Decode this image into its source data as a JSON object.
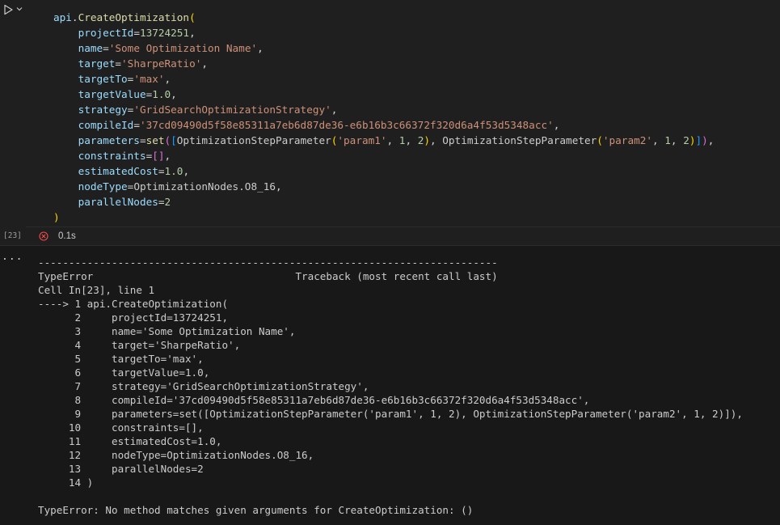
{
  "cell": {
    "execution_count": "[23]",
    "status_icon": "error-circle-icon",
    "duration": "0.1s",
    "code": {
      "line1_obj": "api",
      "line1_fn": "CreateOptimization",
      "projectId_name": "projectId",
      "projectId_value": "13724251",
      "name_name": "name",
      "name_value": "'Some Optimization Name'",
      "target_name": "target",
      "target_value": "'SharpeRatio'",
      "targetTo_name": "targetTo",
      "targetTo_value": "'max'",
      "targetValue_name": "targetValue",
      "targetValue_value": "1.0",
      "strategy_name": "strategy",
      "strategy_value": "'GridSearchOptimizationStrategy'",
      "compileId_name": "compileId",
      "compileId_value": "'37cd09490d5f58e85311a7eb6d87de36-e6b16b3c66372f320d6a4f53d5348acc'",
      "parameters_name": "parameters",
      "set_fn": "set",
      "osp_fn": "OptimizationStepParameter",
      "param1": "'param1'",
      "param2": "'param2'",
      "num1": "1",
      "num2": "2",
      "constraints_name": "constraints",
      "estimatedCost_name": "estimatedCost",
      "estimatedCost_value": "1.0",
      "nodeType_name": "nodeType",
      "nodeType_value": "OptimizationNodes.O8_16",
      "parallelNodes_name": "parallelNodes",
      "parallelNodes_value": "2"
    }
  },
  "output": {
    "more_label": "...",
    "traceback_lines": [
      "---------------------------------------------------------------------------",
      "TypeError                                 Traceback (most recent call last)",
      "Cell In[23], line 1",
      "----> 1 api.CreateOptimization(",
      "      2     projectId=13724251,",
      "      3     name='Some Optimization Name',",
      "      4     target='SharpeRatio',",
      "      5     targetTo='max',",
      "      6     targetValue=1.0,",
      "      7     strategy='GridSearchOptimizationStrategy',",
      "      8     compileId='37cd09490d5f58e85311a7eb6d87de36-e6b16b3c66372f320d6a4f53d5348acc',",
      "      9     parameters=set([OptimizationStepParameter('param1', 1, 2), OptimizationStepParameter('param2', 1, 2)]),",
      "     10     constraints=[],",
      "     11     estimatedCost=1.0,",
      "     12     nodeType=OptimizationNodes.O8_16,",
      "     13     parallelNodes=2",
      "     14 )",
      "",
      "TypeError: No method matches given arguments for CreateOptimization: ()"
    ]
  },
  "colors": {
    "background": "#1f1f1f",
    "output_background": "#181818",
    "error_icon": "#f14c4c",
    "run_icon": "#cccccc"
  }
}
